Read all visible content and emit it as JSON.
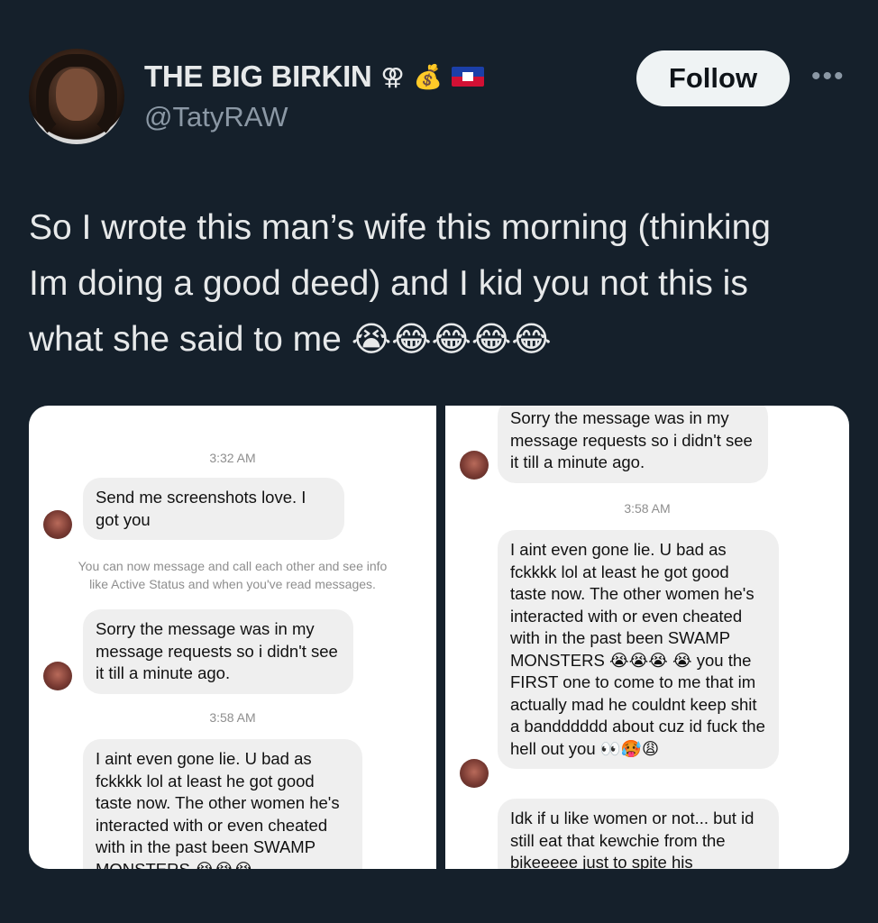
{
  "author": {
    "display_name": "THE BIG BIRKIN",
    "emoji_symbols": "⚢",
    "emoji_money": "💰",
    "handle": "@TatyRAW"
  },
  "actions": {
    "follow_label": "Follow",
    "more_label": "•••"
  },
  "tweet": {
    "text_line1": "So I wrote this man’s wife this morning (thinking",
    "text_line2": "Im doing a good deed) and I kid you not this is",
    "text_line3": "what she said to me",
    "emojis": "😭😂😂😂😂"
  },
  "screenshot_left": {
    "time1": "3:32 AM",
    "msg1": "Send me screenshots love. I got you",
    "system_line1": "You can now message and call each other and see info",
    "system_line2": "like Active Status and when you've read messages.",
    "msg2": "Sorry the message was in my message requests so i didn't see it till a minute ago.",
    "time2": "3:58 AM",
    "msg3": "I aint even gone lie. U bad as fckkkk lol at least he got good taste now. The other women he's interacted with or even cheated with in the past been SWAMP MONSTERS 😭😭😭"
  },
  "screenshot_right": {
    "msg1": "Sorry the message was in my message requests so i didn't see it till a minute ago.",
    "time1": "3:58 AM",
    "msg2": "I aint even gone lie. U bad as fckkkk lol at least he got good taste now. The other women he's interacted with or even cheated with in the past been SWAMP MONSTERS 😭😭😭 😭 you the FIRST one to come to me that im actually mad he couldnt keep shit a bandddddd about cuz id fuck the hell out you 👀🥵😩",
    "msg3": "Idk if u like women or not... but id still eat that kewchie from the bikeeeee just to spite his"
  },
  "colors": {
    "background": "#15202b",
    "text": "#e7e9ea",
    "muted": "#8b98a5",
    "follow_bg": "#eff3f4",
    "bubble": "#efefef"
  },
  "icons": [
    "female-symbol-icon",
    "money-bag-icon",
    "haiti-flag-icon",
    "more-icon"
  ]
}
